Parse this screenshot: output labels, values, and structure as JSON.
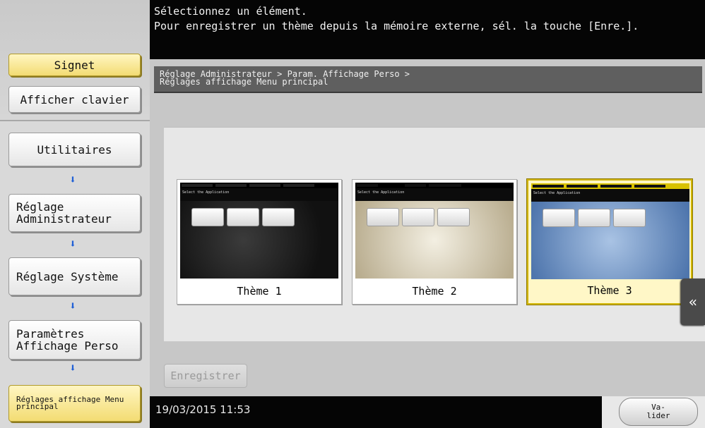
{
  "sidebar": {
    "signet_label": "Signet",
    "keyboard_label": "Afficher clavier",
    "flow": [
      {
        "label": "Utilitaires"
      },
      {
        "label": "Réglage Administrateur"
      },
      {
        "label": "Réglage Système"
      },
      {
        "label": "Paramètres Affichage Perso"
      },
      {
        "label": "Réglages affichage Menu principal"
      }
    ],
    "arrow_glyph": "⬇"
  },
  "header": {
    "line1": "Sélectionnez un élément.",
    "line2": "Pour enregistrer un thème depuis la mémoire externe, sél. la touche [Enre.]."
  },
  "breadcrumb": {
    "line1": "Réglage Administrateur > Param. Affichage Perso >",
    "line2": "Réglages affichage Menu principal"
  },
  "themes": [
    {
      "label": "Thème 1",
      "thumb_title": "Select the Application",
      "selected": false
    },
    {
      "label": "Thème 2",
      "thumb_title": "Select the Application",
      "selected": false
    },
    {
      "label": "Thème 3",
      "thumb_title": "Select the Application",
      "selected": true
    }
  ],
  "side_tab_glyph": "«",
  "register_label": "Enregistrer",
  "footer": {
    "datetime": "19/03/2015  11:53",
    "validate_label": "Va-\nlider"
  },
  "colors": {
    "accent_yellow": "#f3dc73",
    "selected_border": "#d1b400",
    "arrow_blue": "#1f5fd6"
  }
}
